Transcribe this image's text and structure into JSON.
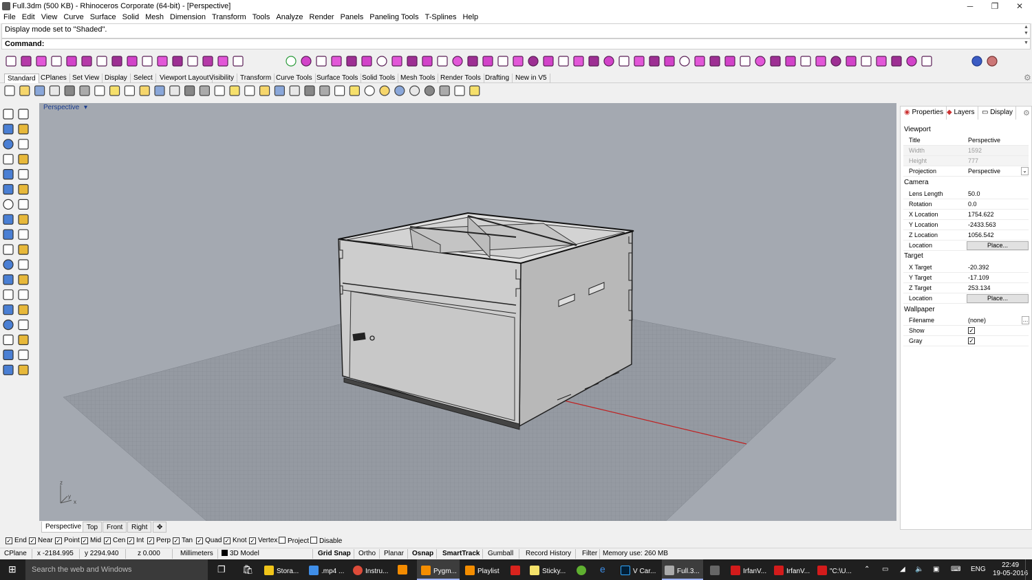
{
  "window": {
    "title": "Full.3dm (500 KB) - Rhinoceros Corporate (64-bit) - [Perspective]",
    "minimize": "─",
    "maximize": "❐",
    "close": "✕"
  },
  "menu": [
    "File",
    "Edit",
    "View",
    "Curve",
    "Surface",
    "Solid",
    "Mesh",
    "Dimension",
    "Transform",
    "Tools",
    "Analyze",
    "Render",
    "Panels",
    "Paneling Tools",
    "T-Splines",
    "Help"
  ],
  "command": {
    "history": "Display mode set to \"Shaded\".",
    "prompt": "Command:"
  },
  "toolbar_tabs": [
    "Standard",
    "CPlanes",
    "Set View",
    "Display",
    "Select",
    "Viewport Layout",
    "Visibility",
    "Transform",
    "Curve Tools",
    "Surface Tools",
    "Solid Tools",
    "Mesh Tools",
    "Render Tools",
    "Drafting",
    "New in V5"
  ],
  "viewport": {
    "title": "Perspective",
    "axes": {
      "z": "z",
      "y": "y",
      "x": "x"
    }
  },
  "viewport_tabs": [
    "Perspective",
    "Top",
    "Front",
    "Right"
  ],
  "panel": {
    "tabs": [
      "Properties",
      "Layers",
      "Display"
    ],
    "viewport_section": "Viewport",
    "title_label": "Title",
    "title_value": "Perspective",
    "width_label": "Width",
    "width_value": "1592",
    "height_label": "Height",
    "height_value": "777",
    "projection_label": "Projection",
    "projection_value": "Perspective",
    "camera_section": "Camera",
    "lens_label": "Lens Length",
    "lens_value": "50.0",
    "rotation_label": "Rotation",
    "rotation_value": "0.0",
    "xloc_label": "X Location",
    "xloc_value": "1754.622",
    "yloc_label": "Y Location",
    "yloc_value": "-2433.563",
    "zloc_label": "Z Location",
    "zloc_value": "1056.542",
    "location_label": "Location",
    "place_button": "Place...",
    "target_section": "Target",
    "xtgt_label": "X Target",
    "xtgt_value": "-20.392",
    "ytgt_label": "Y Target",
    "ytgt_value": "-17.109",
    "ztgt_label": "Z Target",
    "ztgt_value": "253.134",
    "tloc_label": "Location",
    "tplace_button": "Place...",
    "wallpaper_section": "Wallpaper",
    "filename_label": "Filename",
    "filename_value": "(none)",
    "show_label": "Show",
    "gray_label": "Gray"
  },
  "osnap": {
    "end": "End",
    "near": "Near",
    "point": "Point",
    "mid": "Mid",
    "cen": "Cen",
    "int": "Int",
    "perp": "Perp",
    "tan": "Tan",
    "quad": "Quad",
    "knot": "Knot",
    "vertex": "Vertex",
    "project": "Project",
    "disable": "Disable"
  },
  "status": {
    "cplane": "CPlane",
    "x": "x -2184.995",
    "y": "y 2294.940",
    "z": "z 0.000",
    "units": "Millimeters",
    "layer": "3D Model",
    "grid_snap": "Grid Snap",
    "ortho": "Ortho",
    "planar": "Planar",
    "osnap": "Osnap",
    "smarttrack": "SmartTrack",
    "gumball": "Gumball",
    "record_history": "Record History",
    "filter": "Filter",
    "memory": "Memory use: 260 MB"
  },
  "taskbar": {
    "search": "Search the web and Windows",
    "items": [
      "Stora...",
      ".mp4 ...",
      "Instru...",
      "Pygm...",
      "Playlist",
      "Sticky...",
      "V Car...",
      "Full.3...",
      "IrfanV...",
      "IrfanV...",
      "\"C:\\U..."
    ],
    "lang": "ENG",
    "time": "22:49",
    "date": "19-05-2016"
  },
  "colors": {
    "viewport_bg": "#a4a9b1",
    "grid_plane": "#8e939b",
    "box_face_light": "#cfcfcf",
    "box_face_dark": "#b9b9b9",
    "x_axis": "#c02020"
  }
}
